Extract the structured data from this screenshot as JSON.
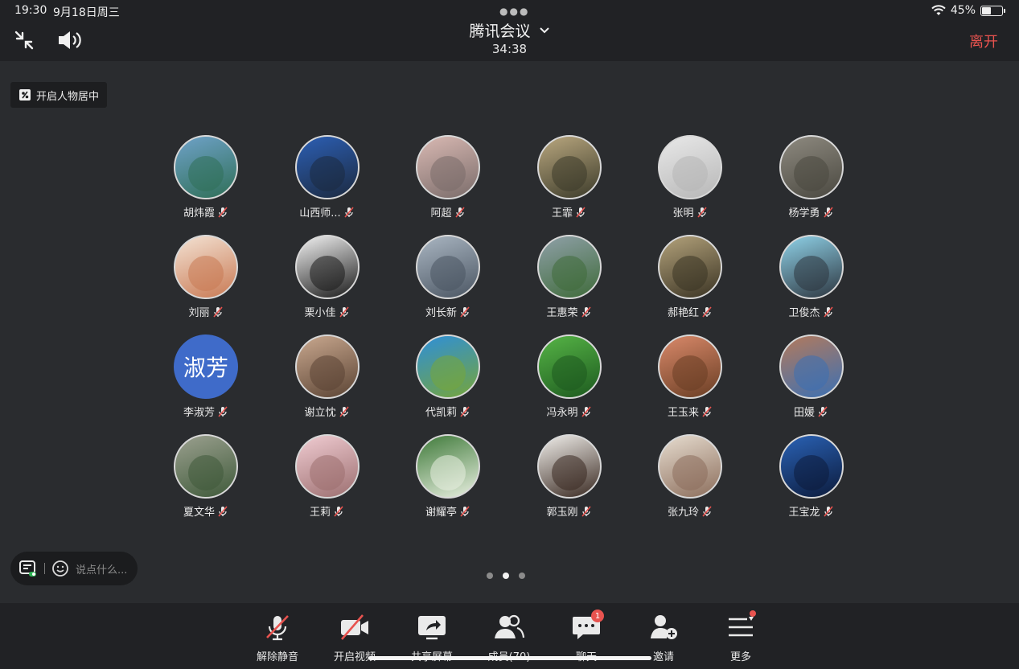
{
  "status": {
    "time": "19:30",
    "date": "9月18日周三",
    "battery": "45%",
    "battery_level": 0.45
  },
  "header": {
    "title": "腾讯会议",
    "timer": "34:38",
    "leave_label": "离开"
  },
  "portrait_chip": {
    "label": "开启人物居中"
  },
  "participants": [
    {
      "name": "胡炜霞",
      "colors": [
        "#6fa2c9",
        "#2f6f57"
      ]
    },
    {
      "name": "山西师...",
      "colors": [
        "#2c5fb4",
        "#1c2a40"
      ]
    },
    {
      "name": "阿超",
      "colors": [
        "#d9b9b3",
        "#7a6c6a"
      ]
    },
    {
      "name": "王霏",
      "colors": [
        "#b9a77f",
        "#3c3b2a"
      ]
    },
    {
      "name": "张明",
      "colors": [
        "#e8e8e8",
        "#b7b7b7"
      ]
    },
    {
      "name": "杨学勇",
      "colors": [
        "#8e8a80",
        "#4a4840"
      ]
    },
    {
      "name": "刘丽",
      "colors": [
        "#f3e2d3",
        "#c97a54"
      ]
    },
    {
      "name": "栗小佳",
      "colors": [
        "#f2f2f2",
        "#1b1b1b"
      ]
    },
    {
      "name": "刘长新",
      "colors": [
        "#aab6c2",
        "#4b5663"
      ]
    },
    {
      "name": "王惠荣",
      "colors": [
        "#8fa0a8",
        "#3f6b3a"
      ]
    },
    {
      "name": "郝艳红",
      "colors": [
        "#b3a27b",
        "#3b3424"
      ]
    },
    {
      "name": "卫俊杰",
      "colors": [
        "#8fd2e8",
        "#2d3640"
      ]
    },
    {
      "name": "李淑芳",
      "text_avatar": "淑芳",
      "colors": [
        "#3f6bc9",
        "#3f6bc9"
      ]
    },
    {
      "name": "谢立忱",
      "colors": [
        "#c9a88f",
        "#5b4434"
      ]
    },
    {
      "name": "代凯莉",
      "colors": [
        "#2e8fd9",
        "#76a53a"
      ]
    },
    {
      "name": "冯永明",
      "colors": [
        "#56b446",
        "#1d5a1f"
      ]
    },
    {
      "name": "王玉来",
      "colors": [
        "#d9896a",
        "#6a3e24"
      ]
    },
    {
      "name": "田媛",
      "colors": [
        "#b37a5c",
        "#3c70b3"
      ]
    },
    {
      "name": "夏文华",
      "colors": [
        "#9ba08f",
        "#3f5a3a"
      ]
    },
    {
      "name": "王莉",
      "colors": [
        "#f0ccd2",
        "#9c6f70"
      ]
    },
    {
      "name": "谢耀亭",
      "colors": [
        "#3f7a3a",
        "#e8efe0"
      ]
    },
    {
      "name": "郭玉刚",
      "colors": [
        "#f0eeea",
        "#3a2a22"
      ]
    },
    {
      "name": "张九玲",
      "colors": [
        "#e6dccf",
        "#8c6e5c"
      ]
    },
    {
      "name": "王宝龙",
      "colors": [
        "#2a62b5",
        "#0c1b3c"
      ]
    }
  ],
  "chat": {
    "placeholder": "说点什么..."
  },
  "pagination": {
    "pages": 3,
    "current": 2
  },
  "toolbar": {
    "unmute": "解除静音",
    "video": "开启视频",
    "share": "共享屏幕",
    "members": "成员(70)",
    "chat": "聊天",
    "chat_badge": "1",
    "invite": "邀请",
    "more": "更多"
  }
}
